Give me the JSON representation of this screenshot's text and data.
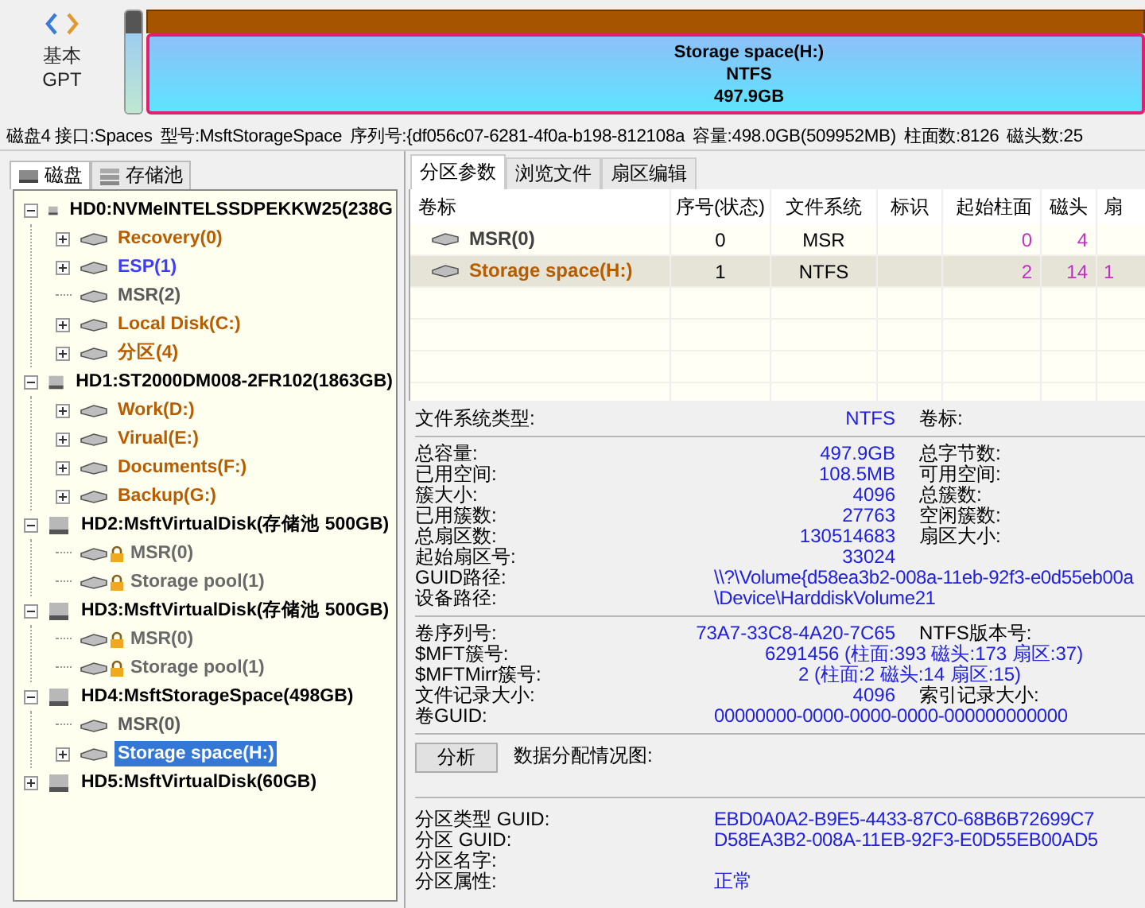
{
  "disk_map": {
    "style": "基本",
    "table": "GPT",
    "partitions": [
      {
        "kind": "msr",
        "selected": false
      },
      {
        "kind": "ntfs",
        "selected": true,
        "name": "Storage space(H:)",
        "fs": "NTFS",
        "size": "497.9GB"
      }
    ]
  },
  "disk_info": [
    "磁盘4 接口:Spaces",
    "型号:MsftStorageSpace",
    "序列号:{df056c07-6281-4f0a-b198-812108a",
    "容量:498.0GB(509952MB)",
    "柱面数:8126",
    "磁头数:25"
  ],
  "left_tabs": [
    {
      "label": "磁盘",
      "kind": "disk",
      "selected": true
    },
    {
      "label": "存储池",
      "kind": "pool",
      "selected": false
    }
  ],
  "tree": [
    {
      "label": "HD0:NVMeINTELSSDPEKKW25(238G",
      "kind": "branch",
      "expanded": true,
      "selected": false,
      "children": [
        {
          "label": "Recovery(0)",
          "kind": "branch",
          "expanded": false,
          "color": "#b85c00",
          "locked": false,
          "selected": false
        },
        {
          "label": "ESP(1)",
          "kind": "branch",
          "expanded": false,
          "color": "#3c3cff",
          "locked": false,
          "selected": false
        },
        {
          "label": "MSR(2)",
          "kind": "leaf",
          "color": "#5a5a5a",
          "locked": false,
          "selected": false
        },
        {
          "label": "Local Disk(C:)",
          "kind": "branch",
          "expanded": false,
          "color": "#b85c00",
          "locked": false,
          "selected": false
        },
        {
          "label": "分区(4)",
          "kind": "branch",
          "expanded": false,
          "color": "#b85c00",
          "locked": false,
          "selected": false
        }
      ]
    },
    {
      "label": "HD1:ST2000DM008-2FR102(1863GB)",
      "kind": "branch",
      "expanded": true,
      "selected": false,
      "children": [
        {
          "label": "Work(D:)",
          "kind": "branch",
          "expanded": false,
          "color": "#b85c00",
          "locked": false,
          "selected": false
        },
        {
          "label": "Virual(E:)",
          "kind": "branch",
          "expanded": false,
          "color": "#b85c00",
          "locked": false,
          "selected": false
        },
        {
          "label": "Documents(F:)",
          "kind": "branch",
          "expanded": false,
          "color": "#b85c00",
          "locked": false,
          "selected": false
        },
        {
          "label": "Backup(G:)",
          "kind": "branch",
          "expanded": false,
          "color": "#b85c00",
          "locked": false,
          "selected": false
        }
      ]
    },
    {
      "label": "HD2:MsftVirtualDisk(存储池 500GB)",
      "kind": "branch",
      "expanded": true,
      "selected": false,
      "children": [
        {
          "label": "MSR(0)",
          "kind": "leaf",
          "color": "#6a6a6a",
          "locked": true,
          "selected": false
        },
        {
          "label": "Storage pool(1)",
          "kind": "leaf",
          "color": "#6a6a6a",
          "locked": true,
          "selected": false
        }
      ]
    },
    {
      "label": "HD3:MsftVirtualDisk(存储池 500GB)",
      "kind": "branch",
      "expanded": true,
      "selected": false,
      "children": [
        {
          "label": "MSR(0)",
          "kind": "leaf",
          "color": "#6a6a6a",
          "locked": true,
          "selected": false
        },
        {
          "label": "Storage pool(1)",
          "kind": "leaf",
          "color": "#6a6a6a",
          "locked": true,
          "selected": false
        }
      ]
    },
    {
      "label": "HD4:MsftStorageSpace(498GB)",
      "kind": "branch",
      "expanded": true,
      "selected": false,
      "children": [
        {
          "label": "MSR(0)",
          "kind": "leaf",
          "color": "#5a5a5a",
          "locked": false,
          "selected": false
        },
        {
          "label": "Storage space(H:)",
          "kind": "branch",
          "expanded": false,
          "locked": false,
          "selected": true
        }
      ]
    },
    {
      "label": "HD5:MsftVirtualDisk(60GB)",
      "kind": "branch",
      "expanded": false,
      "selected": false
    }
  ],
  "right_tabs": [
    {
      "label": "分区参数",
      "selected": true
    },
    {
      "label": "浏览文件",
      "selected": false
    },
    {
      "label": "扇区编辑",
      "selected": false
    }
  ],
  "table": {
    "columns": [
      "卷标",
      "序号(状态)",
      "文件系统",
      "标识",
      "起始柱面",
      "磁头",
      "扇"
    ],
    "rows": [
      {
        "name": "MSR(0)",
        "color": "#404040",
        "index": "0",
        "fs": "MSR",
        "start_cylinder": "0",
        "head": "4",
        "selected": false
      },
      {
        "name": "Storage space(H:)",
        "color": "#b85c00",
        "index": "1",
        "fs": "NTFS",
        "start_cylinder": "2",
        "head": "14",
        "column_7": "1",
        "selected": true
      }
    ]
  },
  "info_sections": [
    {
      "rows": [
        {
          "label": "文件系统类型:",
          "value": "NTFS",
          "kind": "num",
          "label2": "卷标:"
        }
      ]
    },
    {
      "rows": [
        {
          "label": "总容量:",
          "value": "497.9GB",
          "kind": "num",
          "label2": "总字节数:"
        },
        {
          "label": "已用空间:",
          "value": "108.5MB",
          "kind": "num",
          "label2": "可用空间:"
        },
        {
          "label": "簇大小:",
          "value": "4096",
          "kind": "num",
          "label2": "总簇数:"
        },
        {
          "label": "已用簇数:",
          "value": "27763",
          "kind": "num",
          "label2": "空闲簇数:"
        },
        {
          "label": "总扇区数:",
          "value": "130514683",
          "kind": "num",
          "label2": "扇区大小:"
        },
        {
          "label": "起始扇区号:",
          "value": "33024",
          "kind": "num"
        },
        {
          "label": "GUID路径:",
          "value": "\\\\?\\Volume{d58ea3b2-008a-11eb-92f3-e0d55eb00a",
          "kind": "path"
        },
        {
          "label": "设备路径:",
          "value": "\\Device\\HarddiskVolume21",
          "kind": "path"
        }
      ]
    },
    {
      "rows": [
        {
          "label": "卷序列号:",
          "value": "73A7-33C8-4A20-7C65",
          "kind": "num",
          "label2": "NTFS版本号:"
        },
        {
          "label": "$MFT簇号:",
          "value": "6291456 (柱面:393 磁头:173 扇区:37)",
          "kind": "ref"
        },
        {
          "label": "$MFTMirr簇号:",
          "value": "2 (柱面:2 磁头:14 扇区:15)",
          "kind": "ref2"
        },
        {
          "label": "文件记录大小:",
          "value": "4096",
          "kind": "num",
          "label2": "索引记录大小:"
        },
        {
          "label": "卷GUID:",
          "value": "00000000-0000-0000-0000-000000000000",
          "kind": "path"
        }
      ]
    }
  ],
  "analysis": {
    "button": "分析",
    "label": "数据分配情况图:"
  },
  "guid_rows": [
    {
      "label": "分区类型 GUID:",
      "value": "EBD0A0A2-B9E5-4433-87C0-68B6B72699C7"
    },
    {
      "label": "分区 GUID:",
      "value": "D58EA3B2-008A-11EB-92F3-E0D55EB00AD5"
    },
    {
      "label": "分区名字:"
    },
    {
      "label": "分区属性:",
      "value": "正常"
    }
  ]
}
